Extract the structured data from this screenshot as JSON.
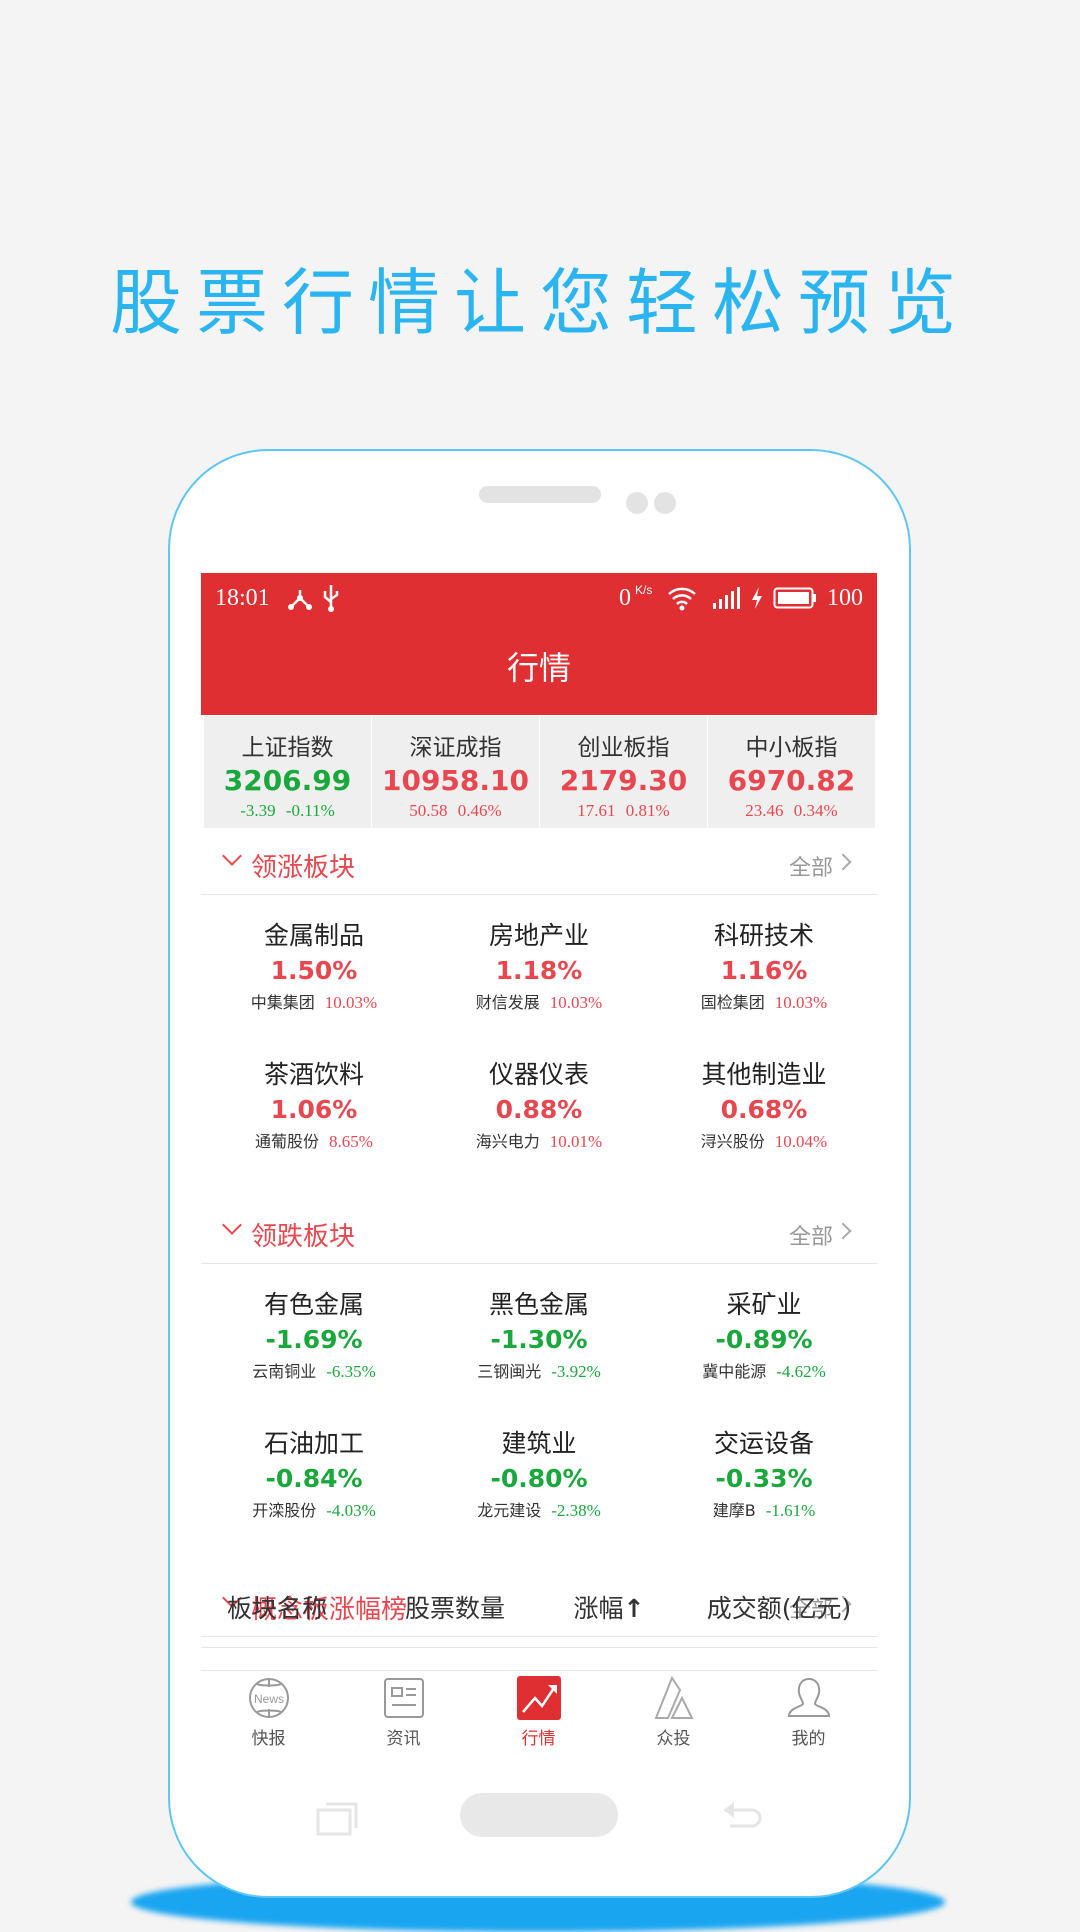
{
  "headline": "股票行情让您轻松预览",
  "status_bar": {
    "time": "18:01",
    "net_speed": "0",
    "net_unit": "K/s",
    "battery": "100"
  },
  "header": {
    "title": "行情"
  },
  "indices": [
    {
      "name": "上证指数",
      "value": "3206.99",
      "change": "-3.39",
      "pct": "-0.11%",
      "trend": "down"
    },
    {
      "name": "深证成指",
      "value": "10958.10",
      "change": "50.58",
      "pct": "0.46%",
      "trend": "up"
    },
    {
      "name": "创业板指",
      "value": "2179.30",
      "change": "17.61",
      "pct": "0.81%",
      "trend": "up"
    },
    {
      "name": "中小板指",
      "value": "6970.82",
      "change": "23.46",
      "pct": "0.34%",
      "trend": "up"
    }
  ],
  "sections": [
    {
      "title": "领涨板块",
      "all": "全部",
      "trend": "up",
      "items": [
        {
          "name": "金属制品",
          "pct": "1.50%",
          "stock": "中集集团",
          "stock_pct": "10.03%"
        },
        {
          "name": "房地产业",
          "pct": "1.18%",
          "stock": "财信发展",
          "stock_pct": "10.03%"
        },
        {
          "name": "科研技术",
          "pct": "1.16%",
          "stock": "国检集团",
          "stock_pct": "10.03%"
        },
        {
          "name": "茶酒饮料",
          "pct": "1.06%",
          "stock": "通葡股份",
          "stock_pct": "8.65%"
        },
        {
          "name": "仪器仪表",
          "pct": "0.88%",
          "stock": "海兴电力",
          "stock_pct": "10.01%"
        },
        {
          "name": "其他制造业",
          "pct": "0.68%",
          "stock": "浔兴股份",
          "stock_pct": "10.04%"
        }
      ]
    },
    {
      "title": "领跌板块",
      "all": "全部",
      "trend": "down",
      "items": [
        {
          "name": "有色金属",
          "pct": "-1.69%",
          "stock": "云南铜业",
          "stock_pct": "-6.35%"
        },
        {
          "name": "黑色金属",
          "pct": "-1.30%",
          "stock": "三钢闽光",
          "stock_pct": "-3.92%"
        },
        {
          "name": "采矿业",
          "pct": "-0.89%",
          "stock": "冀中能源",
          "stock_pct": "-4.62%"
        },
        {
          "name": "石油加工",
          "pct": "-0.84%",
          "stock": "开滦股份",
          "stock_pct": "-4.03%"
        },
        {
          "name": "建筑业",
          "pct": "-0.80%",
          "stock": "龙元建设",
          "stock_pct": "-2.38%"
        },
        {
          "name": "交运设备",
          "pct": "-0.33%",
          "stock": "建摩B",
          "stock_pct": "-1.61%"
        }
      ]
    },
    {
      "title": "概念板涨幅榜",
      "all": "全部"
    }
  ],
  "concept_table": {
    "headers": [
      "板块名称",
      "股票数量",
      "涨幅",
      "成交额(亿元)"
    ],
    "sort_icon": "arrow-up-icon"
  },
  "tabs": [
    {
      "label": "快报",
      "icon": "news-globe-icon"
    },
    {
      "label": "资讯",
      "icon": "newspaper-icon"
    },
    {
      "label": "行情",
      "icon": "trend-chart-icon",
      "active": true
    },
    {
      "label": "众投",
      "icon": "triangles-icon"
    },
    {
      "label": "我的",
      "icon": "user-icon"
    }
  ],
  "colors": {
    "brand_red": "#df2f32",
    "up": "#e8474f",
    "down": "#1aa83c",
    "headline": "#2bb5f0"
  }
}
